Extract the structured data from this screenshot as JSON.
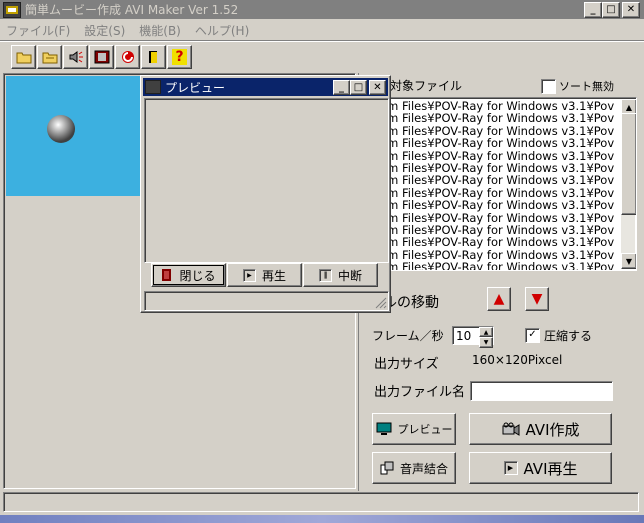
{
  "window": {
    "title": "簡単ムービー作成  AVI Maker Ver 1.52",
    "min_glyph": "_",
    "max_glyph": "□",
    "close_glyph": "✕"
  },
  "menu": [
    "ファイル(F)",
    "設定(S)",
    "機能(B)",
    "ヘルプ(H)"
  ],
  "toolbar": {
    "help_glyph": "?"
  },
  "colors": {
    "preview_bg": "#3cb0e0",
    "titlebar_inactive": "#808080",
    "titlebar_active": "#0a246a",
    "arrow_red": "#d00000"
  },
  "file_list": {
    "label": "対象ファイル",
    "sort_checkbox_label": "ソート無効",
    "sort_checked": false,
    "items": [
      "ogram Files¥POV-Ray for Windows v3.1¥Pov",
      "ogram Files¥POV-Ray for Windows v3.1¥Pov",
      "ogram Files¥POV-Ray for Windows v3.1¥Pov",
      "ogram Files¥POV-Ray for Windows v3.1¥Pov",
      "ogram Files¥POV-Ray for Windows v3.1¥Pov",
      "ogram Files¥POV-Ray for Windows v3.1¥Pov",
      "ogram Files¥POV-Ray for Windows v3.1¥Pov",
      "ogram Files¥POV-Ray for Windows v3.1¥Pov",
      "ogram Files¥POV-Ray for Windows v3.1¥Pov",
      "ogram Files¥POV-Ray for Windows v3.1¥Pov",
      "ogram Files¥POV-Ray for Windows v3.1¥Pov",
      "ogram Files¥POV-Ray for Windows v3.1¥Pov",
      "ogram Files¥POV-Ray for Windows v3.1¥Pov",
      "ogram Files¥POV-Ray for Windows v3.1¥Pov"
    ]
  },
  "move": {
    "label": "ルの移動",
    "up_glyph": "▲",
    "down_glyph": "▼"
  },
  "settings": {
    "fps_label": "フレーム／秒",
    "fps_value": "10",
    "compress_label": "圧縮する",
    "compress_checked": true,
    "size_label": "出力サイズ",
    "size_value": "160×120Pixcel",
    "filename_label": "出力ファイル名",
    "filename_value": ""
  },
  "buttons": {
    "preview": "プレビュー",
    "avi_create": "AVI作成",
    "audio_join": "音声結合",
    "avi_play": "AVI再生"
  },
  "preview_window": {
    "title": "プレビュー",
    "close": "閉じる",
    "play": "再生",
    "stop": "中断"
  }
}
